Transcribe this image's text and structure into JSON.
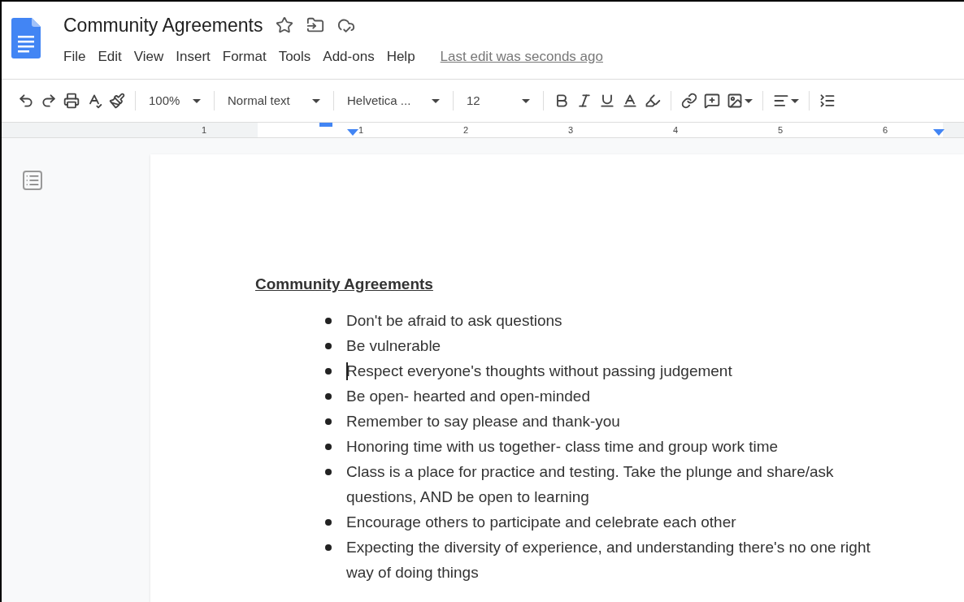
{
  "document": {
    "title": "Community Agreements",
    "last_edit": "Last edit was seconds ago"
  },
  "menu": [
    "File",
    "Edit",
    "View",
    "Insert",
    "Format",
    "Tools",
    "Add-ons",
    "Help"
  ],
  "toolbar": {
    "zoom": "100%",
    "style": "Normal text",
    "font": "Helvetica ...",
    "size": "12"
  },
  "ruler": {
    "labels": [
      "1",
      "1",
      "2",
      "3",
      "4",
      "5",
      "6"
    ]
  },
  "page": {
    "heading": "Community Agreements",
    "items": [
      {
        "text": "Don't be afraid to ask questions",
        "cursor": false
      },
      {
        "text": "Be vulnerable",
        "cursor": false
      },
      {
        "text": "Respect everyone's thoughts without passing judgement",
        "cursor": true
      },
      {
        "text": "Be open- hearted and open-minded",
        "cursor": false
      },
      {
        "text": "Remember to say please and thank-you",
        "cursor": false
      },
      {
        "text": "Honoring time with us together- class time and group work time",
        "cursor": false
      },
      {
        "text": "Class is a place for practice and testing. Take the plunge and share/ask questions, AND be open to learning",
        "cursor": false
      },
      {
        "text": "Encourage others to participate and celebrate each other",
        "cursor": false
      },
      {
        "text": "Expecting the diversity of experience, and understanding there's no one right way of doing things",
        "cursor": false
      }
    ]
  }
}
